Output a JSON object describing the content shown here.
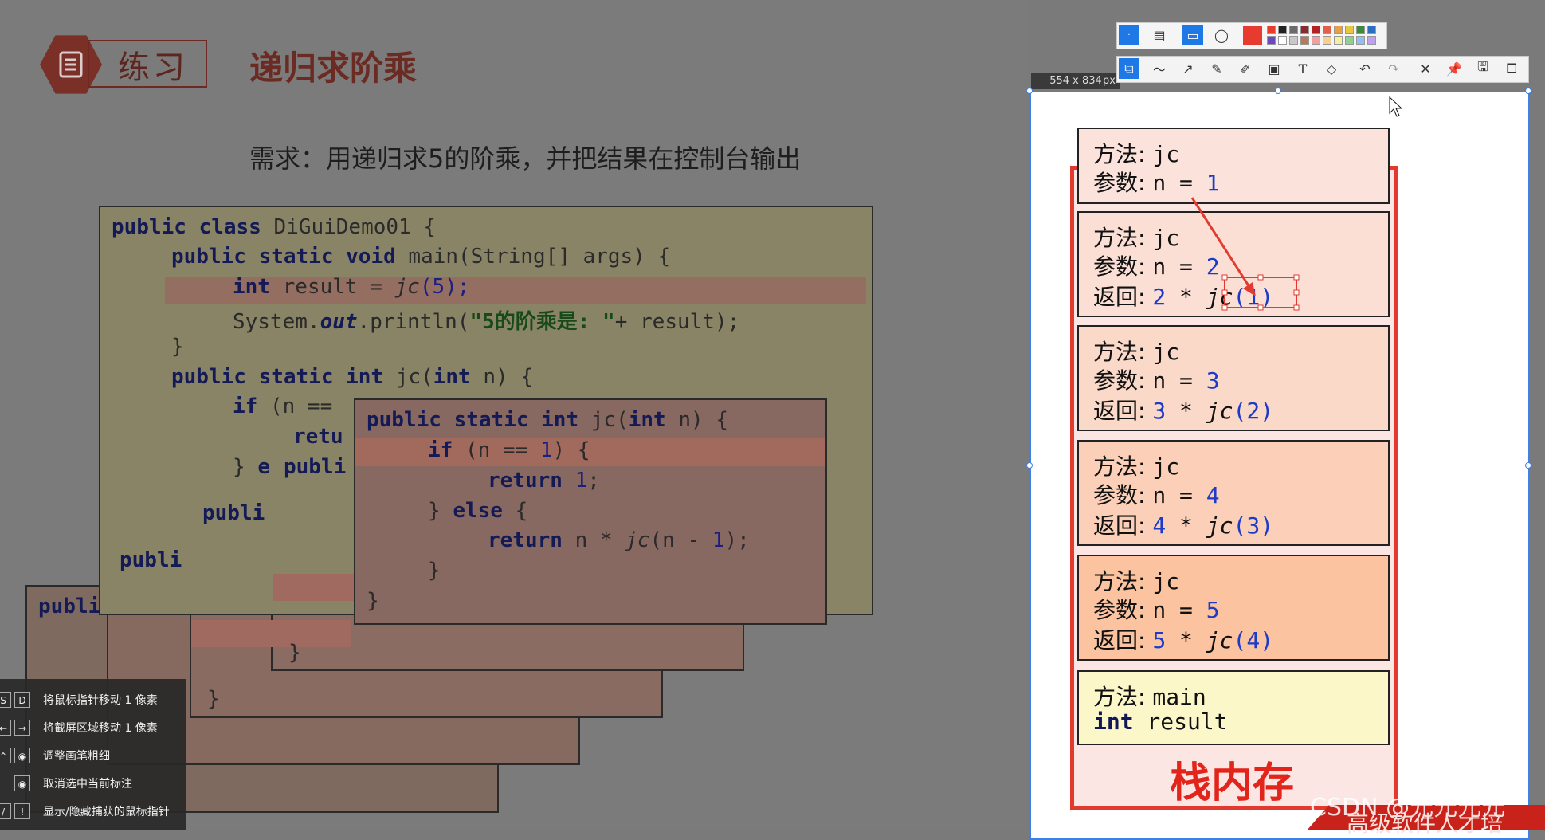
{
  "slide": {
    "badge_label": "练习",
    "title": "递归求阶乘",
    "requirement": "需求：用递归求5的阶乘，并把结果在控制台输出",
    "main_code": {
      "line1_kw": "public class",
      "line1_rest": " DiGuiDemo01 {",
      "line2_kw": "public static void",
      "line2_rest": " main(String[] args) {",
      "line3_kw": "int",
      "line3_rest_a": " result = ",
      "line3_call": "jc",
      "line3_num": "(5);",
      "line4_a": "System.",
      "line4_out": "out",
      "line4_b": ".println(",
      "line4_str": "\"5的阶乘是: \"",
      "line4_c": "+ result);",
      "line5": "}",
      "line6_kw": "public static int",
      "line6_a": " jc(",
      "line6_kw2": "int",
      "line6_b": " n) {",
      "line7_kw": "if",
      "line7_rest": " (n ==",
      "line8_kw": "retu",
      "line9_a": "} ",
      "line9_kw": "e"
    },
    "overlay_code": {
      "line1_kw": "public static int",
      "line1_a": " jc(",
      "line1_kw2": "int",
      "line1_b": " n) {",
      "line2_kw": "if",
      "line2_a": " (n == ",
      "line2_num": "1",
      "line2_b": ") {",
      "line3_kw": "return",
      "line3_num": " 1",
      "line3_b": ";",
      "line4_a": "} ",
      "line4_kw": "else",
      "line4_b": " {",
      "line5_kw": "return",
      "line5_a": " n * ",
      "line5_call": "jc",
      "line5_b": "(n - ",
      "line5_num": "1",
      "line5_c": ");",
      "line6": "}",
      "line7": "}"
    },
    "stack_fragments": {
      "publi": "publi",
      "i": "i",
      "brace": "}"
    }
  },
  "panel": {
    "dimensions": "554 x 834",
    "unit": "px",
    "frames": [
      {
        "method_label": "方法: ",
        "method": "jc",
        "param_label": "参数: ",
        "param": "n = ",
        "param_val": "1",
        "ret_label": "",
        "ret_a": "",
        "ret_call": "",
        "ret_arg": "",
        "bg": "#fbe3dc"
      },
      {
        "method_label": "方法: ",
        "method": "jc",
        "param_label": "参数: ",
        "param": "n = ",
        "param_val": "2",
        "ret_label": "返回: ",
        "ret_a": "2",
        "ret_call": " * jc",
        "ret_arg": "(1)",
        "bg": "#fbdfd5"
      },
      {
        "method_label": "方法: ",
        "method": "jc",
        "param_label": "参数: ",
        "param": "n = ",
        "param_val": "3",
        "ret_label": "返回: ",
        "ret_a": "3",
        "ret_call": " * jc",
        "ret_arg": "(2)",
        "bg": "#fbd9c9"
      },
      {
        "method_label": "方法: ",
        "method": "jc",
        "param_label": "参数: ",
        "param": "n = ",
        "param_val": "4",
        "ret_label": "返回: ",
        "ret_a": "4",
        "ret_call": " * jc",
        "ret_arg": "(3)",
        "bg": "#fbcfb8"
      },
      {
        "method_label": "方法: ",
        "method": "jc",
        "param_label": "参数: ",
        "param": "n = ",
        "param_val": "5",
        "ret_label": "返回: ",
        "ret_a": "5",
        "ret_call": " * jc",
        "ret_arg": "(4)",
        "bg": "#fbc39f"
      },
      {
        "method_label": "方法: ",
        "method": "main",
        "param_label": "",
        "param": "",
        "param_val": "",
        "int_kw": "int",
        "int_var": " result",
        "bg": "#fcf7c8"
      }
    ],
    "stack_label": "栈内存"
  },
  "hints": [
    {
      "keys": [
        "S",
        "D"
      ],
      "label": "将鼠标指针移动 1 像素"
    },
    {
      "keys": [
        "←",
        "→"
      ],
      "label": "将截屏区域移动 1 像素"
    },
    {
      "keys": [
        "⌃",
        "◉"
      ],
      "label": "调整画笔粗细"
    },
    {
      "keys": [
        "◉"
      ],
      "label": "取消选中当前标注"
    },
    {
      "keys": [
        "/",
        "!"
      ],
      "label": "显示/隐藏捕获的鼠标指针"
    }
  ],
  "watermark": {
    "csdn": "CSDN @元元元元",
    "brand": "高级软件人才培"
  },
  "colors": {
    "stack_border": "#e23a2e",
    "selection_blue": "#3c82e6",
    "palette": [
      "#e63b2e",
      "#222222",
      "#6b6b6b",
      "#8a2a2a",
      "#b22222",
      "#e0604a",
      "#e8a040",
      "#e8c840",
      "#3a8a3a",
      "#2e6ec0",
      "#6a48c0",
      "#ffffff",
      "#c8c8c8",
      "#b87a5a",
      "#f0a0a0",
      "#f5d090",
      "#f5f0a0",
      "#90d090",
      "#90c0f0",
      "#c0a0f0"
    ]
  }
}
